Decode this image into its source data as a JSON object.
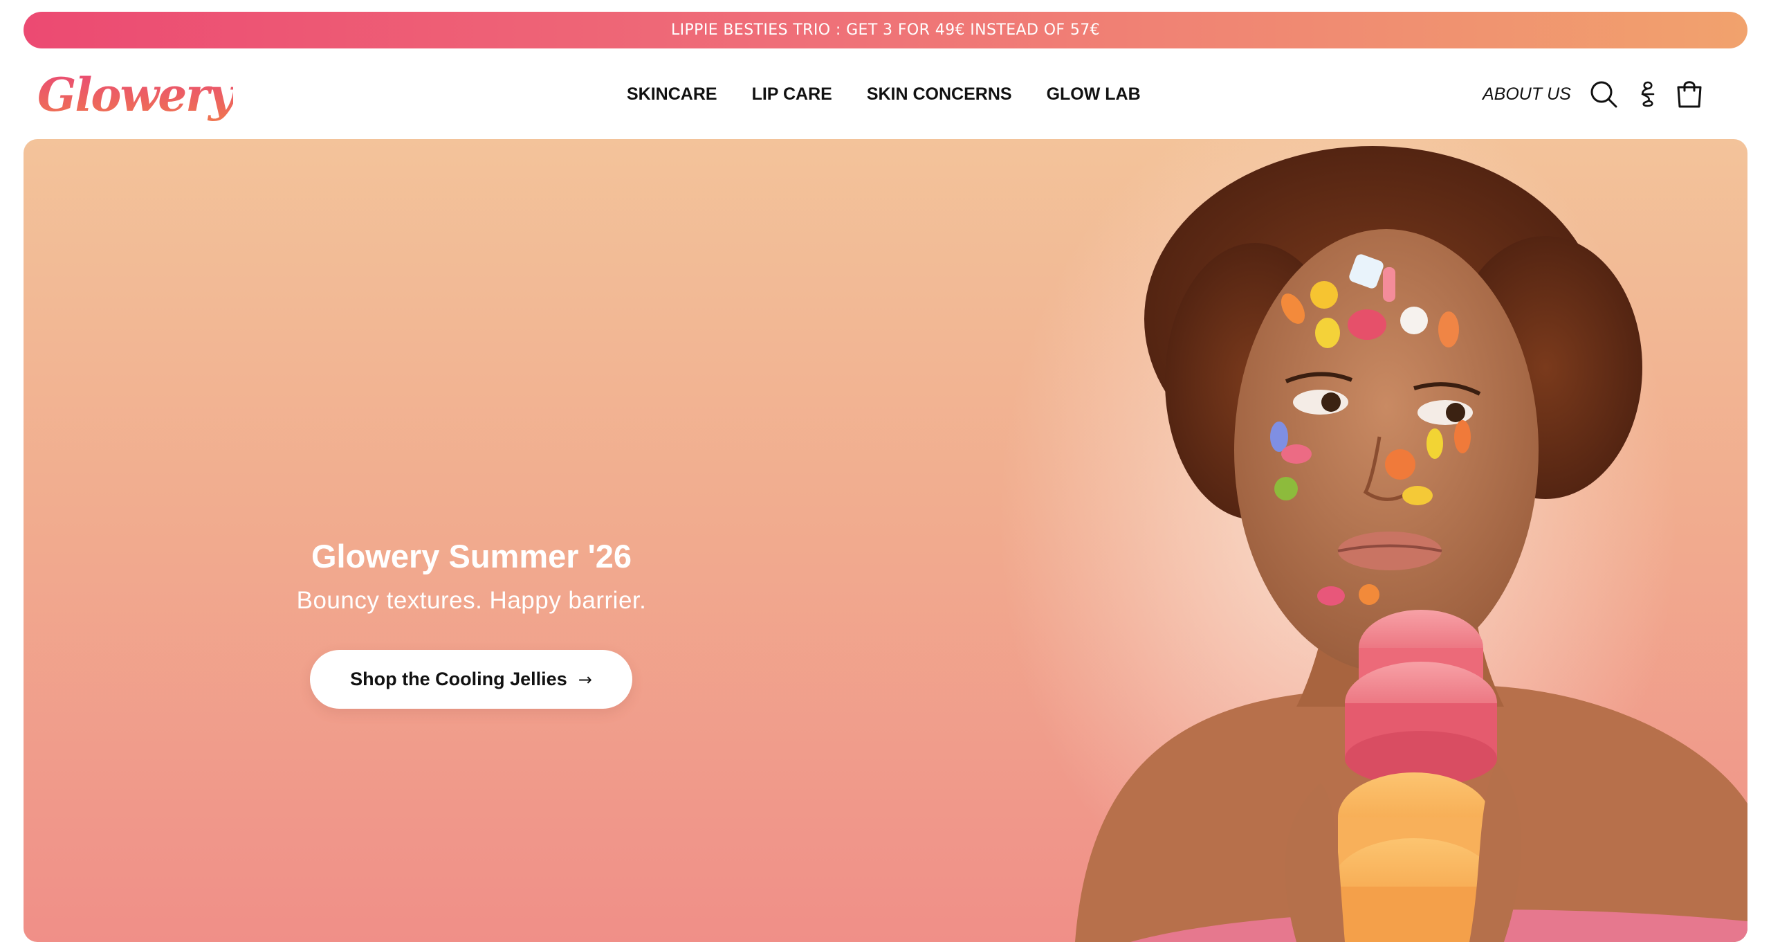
{
  "promo": {
    "text": "LIPPIE BESTIES TRIO : GET 3 FOR 49€ INSTEAD OF 57€"
  },
  "header": {
    "logo_text": "Glowery",
    "nav": [
      {
        "label": "SKINCARE"
      },
      {
        "label": "LIP CARE"
      },
      {
        "label": "SKIN CONCERNS"
      },
      {
        "label": "GLOW LAB"
      }
    ],
    "about_label": "ABOUT US",
    "icons": [
      "search-icon",
      "account-icon",
      "shopping-bag-icon"
    ]
  },
  "hero": {
    "title": "Glowery Summer '26",
    "subtitle": "Bouncy textures. Happy barrier.",
    "cta_label": "Shop the Cooling Jellies",
    "cta_arrow": "→",
    "image": "model-with-fruit-stickers-holding-jelly-jars"
  },
  "colors": {
    "promo_start": "#ec4a72",
    "promo_end": "#f1a26d",
    "hero_top": "#f3c39a",
    "hero_bottom": "#f08f88",
    "text_dark": "#111111"
  }
}
